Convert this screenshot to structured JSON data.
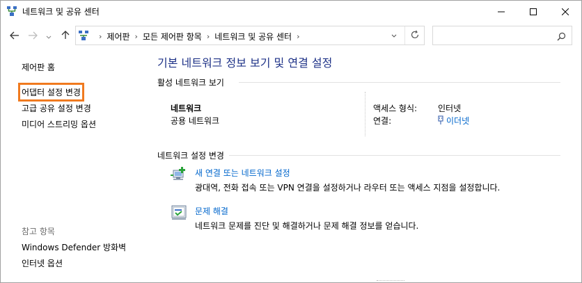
{
  "window": {
    "title": "네트워크 및 공유 센터",
    "minimize_icon": "minimize-icon",
    "maximize_icon": "maximize-icon",
    "close_icon": "close-icon"
  },
  "nav": {
    "crumbs": [
      "제어판",
      "모든 제어판 항목",
      "네트워크 및 공유 센터"
    ],
    "search_placeholder": ""
  },
  "left": {
    "home": "제어판 홈",
    "links": [
      "어댑터 설정 변경",
      "고급 공유 설정 변경",
      "미디어 스트리밍 옵션"
    ],
    "see_also_label": "참고 항목",
    "see_also": [
      "Windows Defender 방화벽",
      "인터넷 옵션"
    ],
    "highlight_color": "#f07a1f"
  },
  "main": {
    "title": "기본 네트워크 정보 보기 및 연결 설정",
    "active_section": "활성 네트워크 보기",
    "network": {
      "name": "네트워크",
      "type": "공용 네트워크",
      "access_label": "액세스 형식:",
      "access_value": "인터넷",
      "connection_label": "연결:",
      "connection_value": "이더넷"
    },
    "change_section": "네트워크 설정 변경",
    "tasks": [
      {
        "label": "새 연결 또는 네트워크 설정",
        "description": "광대역, 전화 접속 또는 VPN 연결을 설정하거나 라우터 또는 액세스 지점을 설정합니다."
      },
      {
        "label": "문제 해결",
        "description": "네트워크 문제를 진단 및 해결하거나 문제 해결 정보를 얻습니다."
      }
    ]
  },
  "colors": {
    "title_blue": "#1e3287",
    "link_blue": "#0066cc"
  }
}
